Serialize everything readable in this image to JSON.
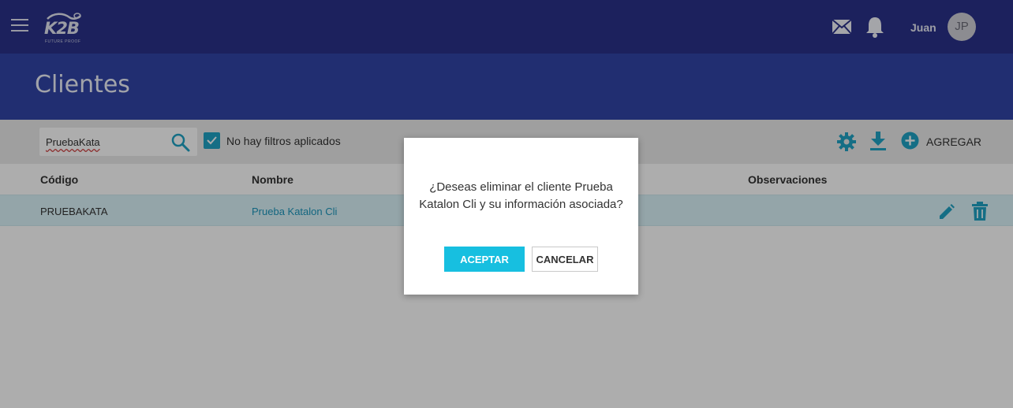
{
  "app": {
    "logo_text": "K2B",
    "logo_tagline": "FUTURE PROOF",
    "user_name": "Juan",
    "user_initials": "JP",
    "colors": {
      "topbar": "#2a318a",
      "banner": "#3144a7",
      "accent": "#1fa3c4",
      "accept_button": "#17bfe0"
    }
  },
  "page": {
    "title": "Clientes"
  },
  "toolbar": {
    "search_value": "PruebaKata",
    "filter_label": "No hay filtros aplicados",
    "add_label": "AGREGAR",
    "icons": [
      "search-icon",
      "gear-icon",
      "download-icon",
      "add-circle-icon"
    ]
  },
  "table": {
    "columns": [
      "Código",
      "Nombre",
      "Observaciones"
    ],
    "rows": [
      {
        "codigo": "PRUEBAKATA",
        "nombre": "Prueba Katalon Cli",
        "observaciones": ""
      }
    ]
  },
  "dialog": {
    "message": "¿Deseas eliminar el cliente Prueba Katalon Cli y su información asociada?",
    "accept_label": "ACEPTAR",
    "cancel_label": "CANCELAR"
  }
}
